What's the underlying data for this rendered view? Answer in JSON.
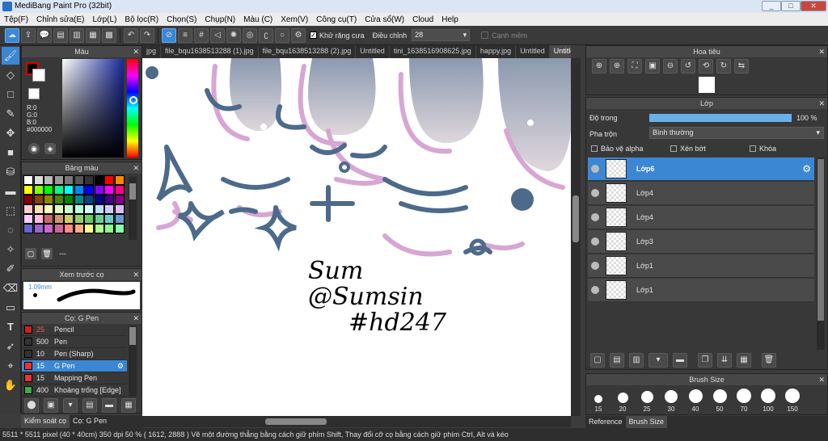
{
  "window": {
    "title": "MediBang Paint Pro (32bit)"
  },
  "menu": [
    "Tệp(F)",
    "Chỉnh sửa(E)",
    "Lớp(L)",
    "Bộ lọc(R)",
    "Chọn(S)",
    "Chụp(N)",
    "Màu (C)",
    "Xem(V)",
    "Công cụ(T)",
    "Cửa sổ(W)",
    "Cloud",
    "Help"
  ],
  "toolbar": {
    "antialias_label": "Khử răng cưa",
    "adjust_label": "Điều chỉnh",
    "adjust_value": "28",
    "edge_label": "Cạnh mềm"
  },
  "tabs": [
    "jpg",
    "file_bqu1638513288 (1).jpg",
    "file_bqu1638513288 (2).jpg",
    "Untitled",
    "tini_1638516908625.jpg",
    "happy.jpg",
    "Untitled",
    "Untitled"
  ],
  "color_panel": {
    "title": "Màu",
    "r": "R:0",
    "g": "G:0",
    "b": "B:0",
    "hex": "#000000"
  },
  "palette_panel": {
    "title": "Bảng màu",
    "extra": "---"
  },
  "preview_panel": {
    "title": "Xem trước cọ",
    "size": "1.09mm"
  },
  "brush_panel": {
    "title": "Cọ: G Pen",
    "items": [
      {
        "size": "25",
        "name": "Pencil",
        "color": "#c22"
      },
      {
        "size": "500",
        "name": "Pen",
        "color": "#333"
      },
      {
        "size": "10",
        "name": "Pen (Sharp)",
        "color": "#333"
      },
      {
        "size": "15",
        "name": "G Pen",
        "color": "#e33"
      },
      {
        "size": "15",
        "name": "Mapping Pen",
        "color": "#e33"
      },
      {
        "size": "400",
        "name": "Khoảng trống [Edge]",
        "color": "#4a4"
      }
    ],
    "selected_index": 3
  },
  "bottom_tabs": [
    "Kiểm soát cọ",
    "Cọ: G Pen"
  ],
  "navigator_panel": {
    "title": "Hoa tiêu"
  },
  "layer_panel": {
    "title": "Lớp",
    "opacity_label": "Độ trong",
    "opacity_value": "100 %",
    "opacity_fraction": 1.0,
    "blend_label": "Pha trộn",
    "blend_value": "Bình thường",
    "protect_alpha": "Bảo vệ alpha",
    "clipping": "Xén bớt",
    "lock": "Khóa",
    "layers": [
      "Lớp6",
      "Lớp4",
      "Lớp4",
      "Lớp3",
      "Lớp1",
      "Lớp1"
    ],
    "selected_index": 0
  },
  "brush_size_panel": {
    "title": "Brush Size",
    "sizes": [
      "15",
      "20",
      "25",
      "30",
      "40",
      "50",
      "70",
      "100",
      "150"
    ]
  },
  "right_bottom_tabs": [
    "Reference",
    "Brush Size"
  ],
  "canvas_text": [
    "Sum",
    "@Sumsin",
    "#hd247"
  ],
  "status": {
    "text": "5511 * 5511 pixel  (40 * 40cm)  350 dpi  50 %  ( 1612, 2888 )  Vẽ một đường thẳng bằng cách giữ phím Shift, Thay đổi cỡ cọ bằng cách giữ phím Ctrl, Alt và kéo"
  }
}
